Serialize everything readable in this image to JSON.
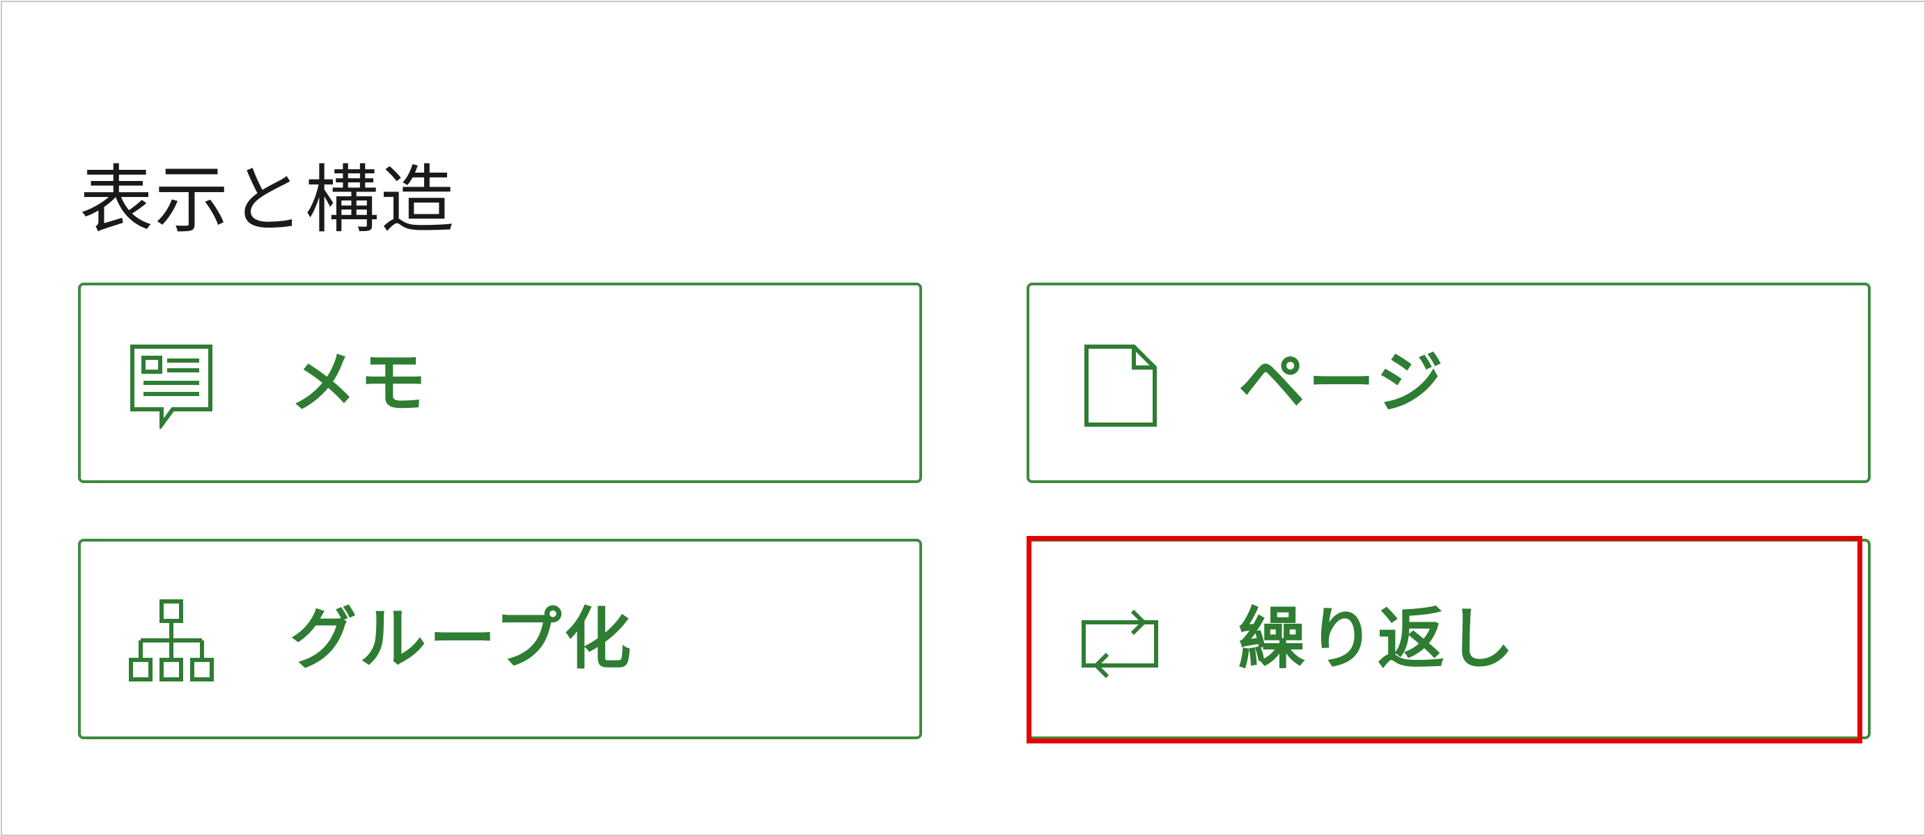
{
  "section": {
    "title": "表示と構造"
  },
  "tiles": [
    {
      "label": "メモ",
      "icon": "memo-icon"
    },
    {
      "label": "ページ",
      "icon": "page-icon"
    },
    {
      "label": "グループ化",
      "icon": "group-icon"
    },
    {
      "label": "繰り返し",
      "icon": "repeat-icon"
    }
  ],
  "colors": {
    "accent": "#2e7d32",
    "tile_border": "#3d8b3d",
    "highlight": "#e60000",
    "title_text": "#1a1a1a"
  },
  "highlighted_tile": "繰り返し"
}
